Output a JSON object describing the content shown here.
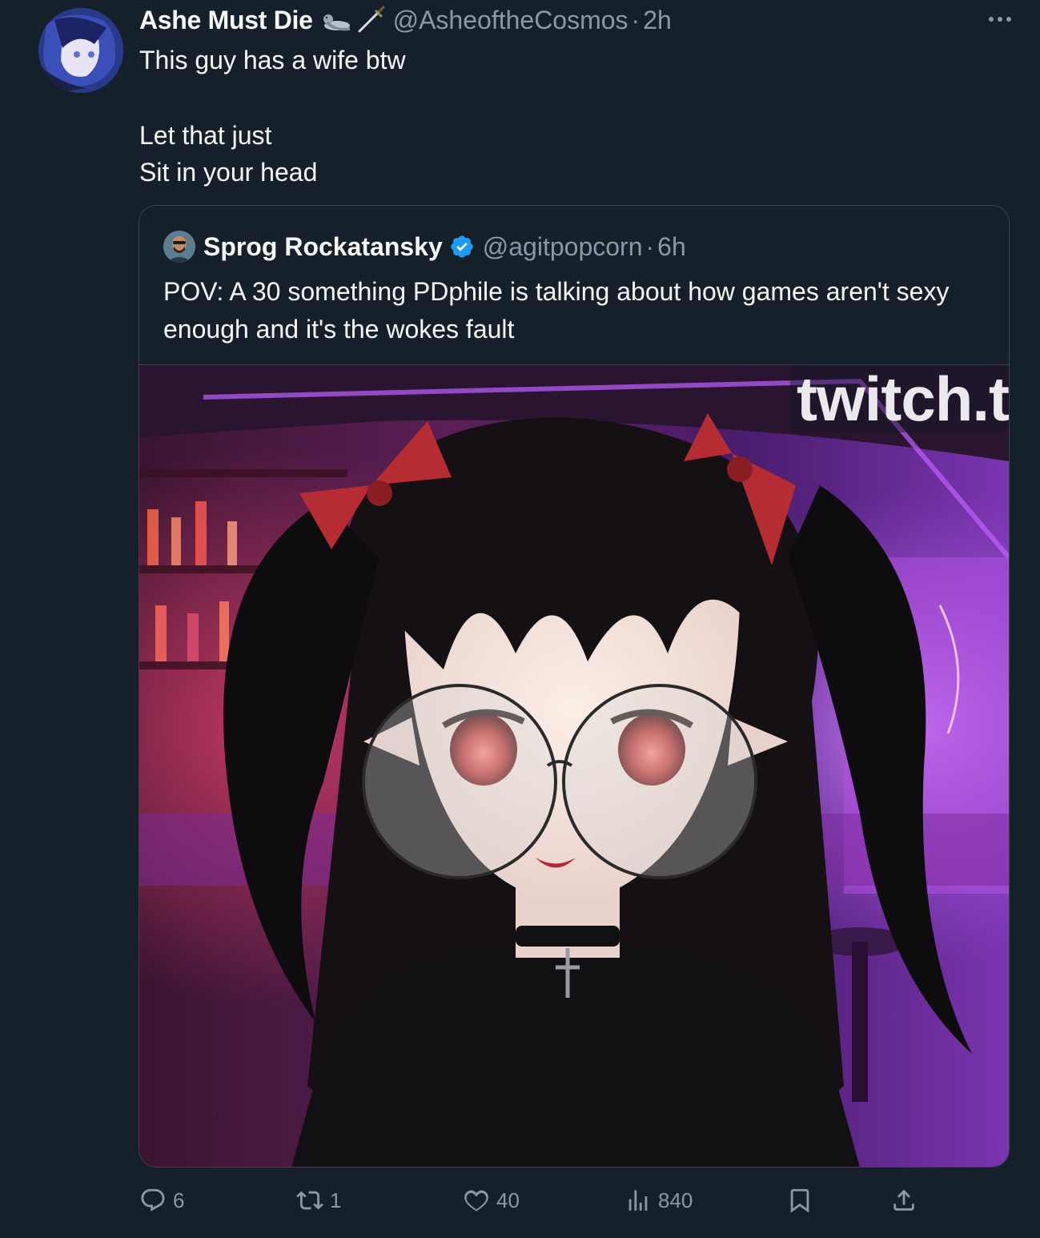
{
  "tweet": {
    "display_name": "Ashe Must Die",
    "emoji_icons": [
      "seal-emoji",
      "dagger-emoji"
    ],
    "handle": "@AsheoftheCosmos",
    "separator": "·",
    "time": "2h",
    "text_lines": [
      "This guy has a wife btw",
      "Let that just",
      "Sit in your head"
    ]
  },
  "quote": {
    "display_name": "Sprog Rockatansky",
    "handle": "@agitpopcorn",
    "separator": "·",
    "time": "6h",
    "text": "POV: A 30 something PDphile is talking about how games aren't sexy enough and it's the wokes fault",
    "media_watermark": "twitch.t"
  },
  "actions": {
    "replies": "6",
    "retweets": "1",
    "likes": "40",
    "views": "840"
  },
  "colors": {
    "background": "#15202b",
    "text": "#f7f9f9",
    "secondary": "#8b98a5",
    "border": "#38444d",
    "verified": "#1d9bf0"
  }
}
